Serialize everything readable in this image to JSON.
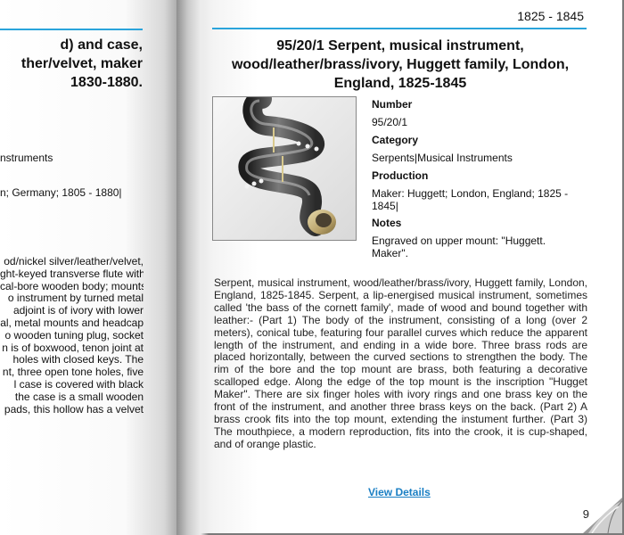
{
  "left_page": {
    "title_lines": [
      "d) and case,",
      "ther/velvet, maker",
      "1830-1880."
    ],
    "category_value": "nstruments",
    "production_value": "n; Germany; 1805 - 1880|",
    "paragraph_lines": [
      "od/nickel silver/leather/velvet,",
      "ght-keyed transverse flute with",
      "cal-bore wooden body; mounts",
      "o instrument by turned metal",
      "adjoint is of ivory with lower",
      "al, metal mounts and headcap",
      "o wooden tuning plug, socket",
      "n is of boxwood, tenon joint at",
      "holes with closed keys. The",
      "nt, three open tone holes, five",
      "l case is covered with black",
      "the case is a small wooden",
      "pads, this hollow has a velvet"
    ]
  },
  "right_page": {
    "header_date": "1825 - 1845",
    "title": "95/20/1 Serpent, musical instrument, wood/leather/brass/ivory, Huggett family, London, England, 1825-1845",
    "fields": {
      "number_label": "Number",
      "number_value": "95/20/1",
      "category_label": "Category",
      "category_value": "Serpents|Musical Instruments",
      "production_label": "Production",
      "production_value": "Maker: Huggett; London, England; 1825 - 1845|",
      "notes_label": "Notes",
      "notes_value": "Engraved on upper mount: \"Huggett. Maker\"."
    },
    "description": "Serpent, musical instrument, wood/leather/brass/ivory, Huggett family, London, England, 1825-1845. Serpent, a lip-energised musical instrument, sometimes called 'the bass of the cornett family', made of wood and bound together with leather:- (Part 1) The body of the instrument, consisting of a long (over 2 meters), conical tube, featuring four parallel curves which reduce the apparent length of the instrument, and ending in a wide bore. Three brass rods are placed horizontally, between the curved sections to strengthen the body. The rim of the bore and the top mount are brass, both featuring a decorative scalloped edge. Along the edge of the top mount is the inscription \"Hugget Maker\". There are six finger holes with ivory rings and one brass key on the front of the instrument, and another three brass keys on the back. (Part 2) A brass crook fits into the top mount, extending the instument further. (Part 3) The mouthpiece, a modern reproduction, fits into the crook, it is cup-shaped, and of orange plastic.",
    "view_details_label": "View Details",
    "page_number": "9"
  },
  "colors": {
    "accent_rule": "#2aa4db",
    "link": "#1a7fc4"
  },
  "icons": {
    "page_curl": "page-curl-icon",
    "photo": "serpent-photo"
  }
}
